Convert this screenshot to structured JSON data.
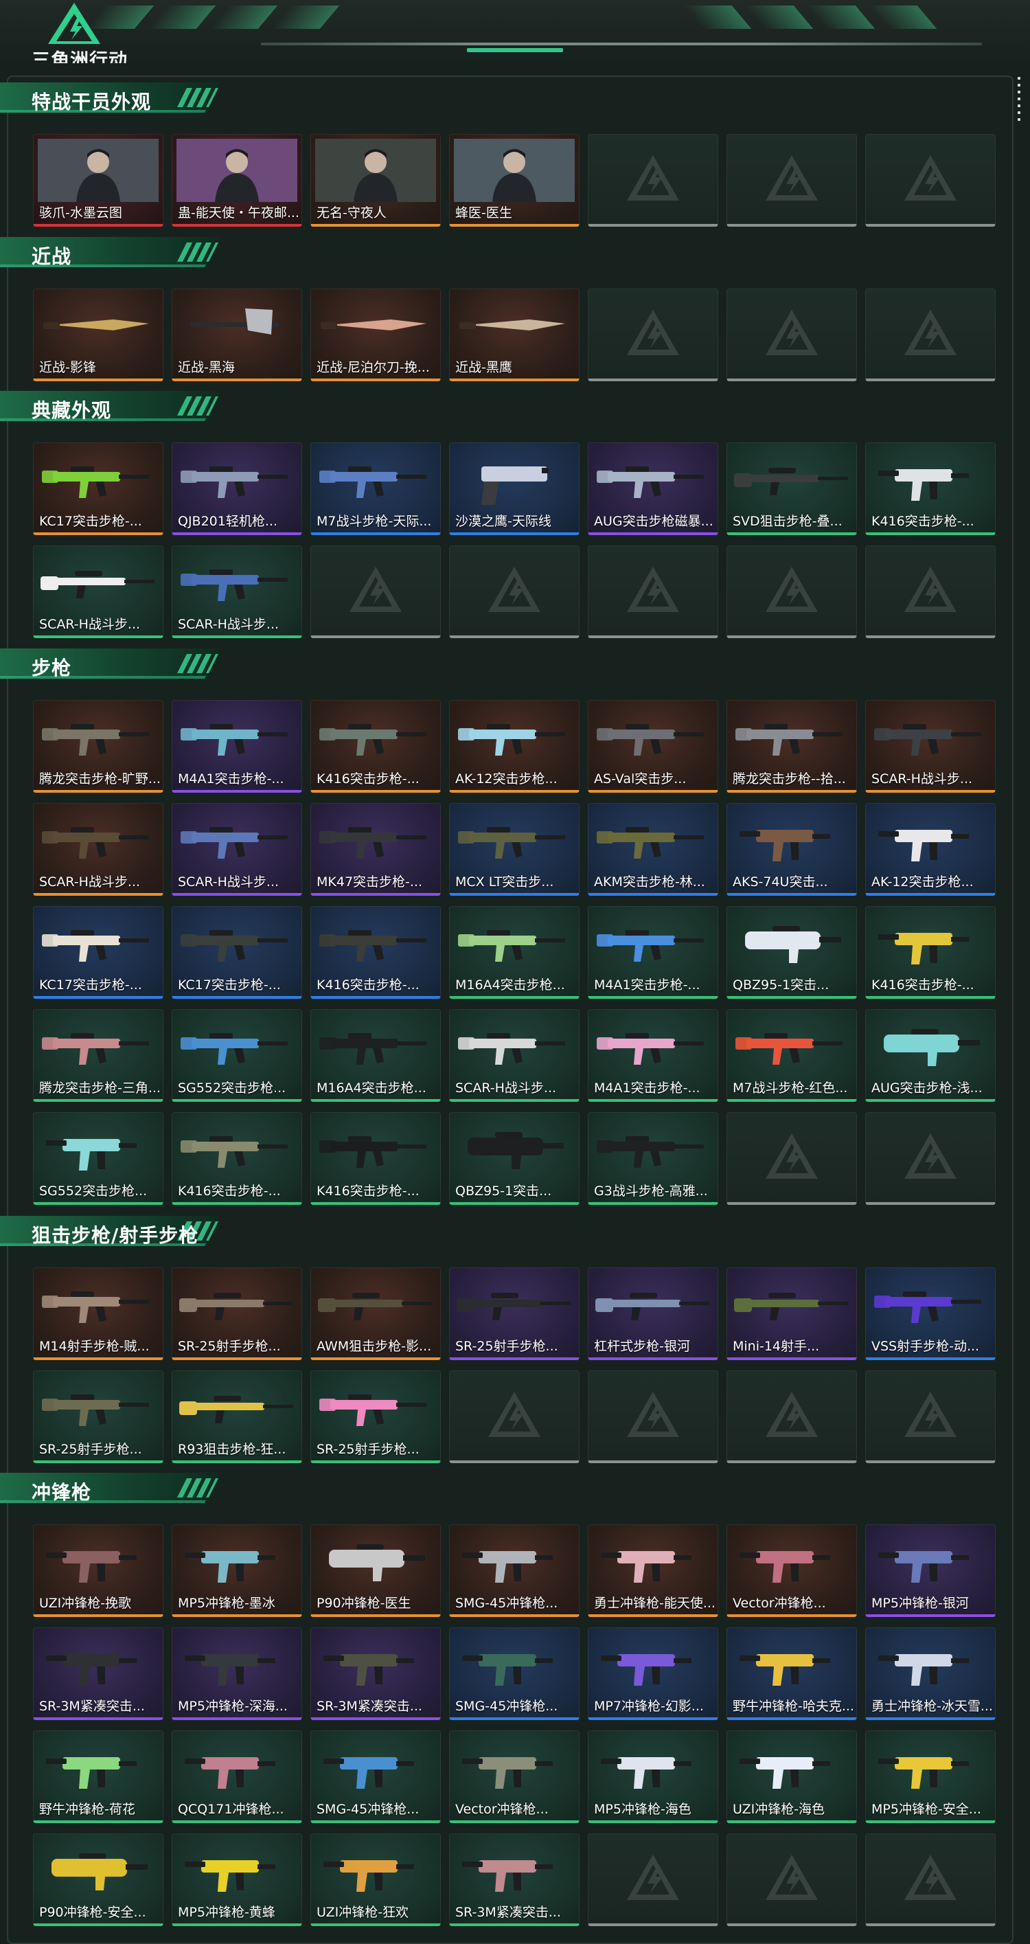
{
  "app": {
    "title": "三角洲行动"
  },
  "colors": {
    "orange": "#e8912f",
    "purple": "#8a4fe6",
    "blue": "#2e7fe8",
    "green": "#35c27a",
    "red": "#d5343a",
    "accent": "#36c58a"
  },
  "sections": [
    {
      "title": "特战干员外观",
      "rows": 1,
      "items": [
        {
          "label": "骇爪-水墨云图",
          "rarity": "red",
          "kind": "portrait",
          "tone": "#4a4f57"
        },
        {
          "label": "蛊-能天使・午夜邮...",
          "rarity": "red",
          "kind": "portrait",
          "tone": "#6c4a7a"
        },
        {
          "label": "无名-守夜人",
          "rarity": "orange",
          "kind": "portrait",
          "tone": "#3e4541"
        },
        {
          "label": "蜂医-医生",
          "rarity": "orange",
          "kind": "portrait",
          "tone": "#4d5a62"
        }
      ]
    },
    {
      "title": "近战",
      "rows": 1,
      "items": [
        {
          "label": "近战-影锋",
          "rarity": "orange",
          "kind": "knife",
          "tone": "#c9a860"
        },
        {
          "label": "近战-黑海",
          "rarity": "orange",
          "kind": "axe",
          "tone": "#b8bcc0"
        },
        {
          "label": "近战-尼泊尔刀-挽...",
          "rarity": "orange",
          "kind": "knife",
          "tone": "#d7a48e"
        },
        {
          "label": "近战-黑鹰",
          "rarity": "orange",
          "kind": "knife",
          "tone": "#c9b59a"
        }
      ]
    },
    {
      "title": "典藏外观",
      "rows": 2,
      "items": [
        {
          "label": "KC17突击步枪-...",
          "rarity": "orange",
          "kind": "rifle",
          "tone": "#7fd13a"
        },
        {
          "label": "QJB201轻机枪...",
          "rarity": "purple",
          "kind": "rifle",
          "tone": "#8e9bb6"
        },
        {
          "label": "M7战斗步枪-天际...",
          "rarity": "blue",
          "kind": "rifle",
          "tone": "#5c7fc4"
        },
        {
          "label": "沙漠之鹰-天际线",
          "rarity": "blue",
          "kind": "pistol",
          "tone": "#c8cfe0"
        },
        {
          "label": "AUG突击步枪磁暴...",
          "rarity": "purple",
          "kind": "rifle",
          "tone": "#a7b4c8"
        },
        {
          "label": "SVD狙击步枪-叠...",
          "rarity": "green",
          "kind": "sniper",
          "tone": "#3a3d3c"
        },
        {
          "label": "K416突击步枪-...",
          "rarity": "green",
          "kind": "smg",
          "tone": "#dfe3e6"
        },
        {
          "label": "SCAR-H战斗步...",
          "rarity": "green",
          "kind": "sniper",
          "tone": "#eeeeee"
        },
        {
          "label": "SCAR-H战斗步...",
          "rarity": "green",
          "kind": "rifle",
          "tone": "#4a6fb8"
        }
      ]
    },
    {
      "title": "步枪",
      "rows": 5,
      "items": [
        {
          "label": "腾龙突击步枪-旷野...",
          "rarity": "orange",
          "kind": "rifle",
          "tone": "#7a7566"
        },
        {
          "label": "M4A1突击步枪-...",
          "rarity": "purple",
          "kind": "rifle",
          "tone": "#6fb4c8"
        },
        {
          "label": "K416突击步枪-...",
          "rarity": "orange",
          "kind": "rifle",
          "tone": "#6b7a70"
        },
        {
          "label": "AK-12突击步枪...",
          "rarity": "orange",
          "kind": "rifle",
          "tone": "#9fd3e6"
        },
        {
          "label": "AS-Val突击步...",
          "rarity": "orange",
          "kind": "rifle",
          "tone": "#6d6f74"
        },
        {
          "label": "腾龙突击步枪--拾...",
          "rarity": "orange",
          "kind": "rifle",
          "tone": "#8a8c94"
        },
        {
          "label": "SCAR-H战斗步...",
          "rarity": "orange",
          "kind": "rifle",
          "tone": "#3d4045"
        },
        {
          "label": "SCAR-H战斗步...",
          "rarity": "orange",
          "kind": "rifle",
          "tone": "#5a4a36"
        },
        {
          "label": "SCAR-H战斗步...",
          "rarity": "purple",
          "kind": "rifle",
          "tone": "#5d78b8"
        },
        {
          "label": "MK47突击步枪-...",
          "rarity": "purple",
          "kind": "rifle",
          "tone": "#34363a"
        },
        {
          "label": "MCX LT突击步...",
          "rarity": "blue",
          "kind": "rifle",
          "tone": "#5e6140"
        },
        {
          "label": "AKM突击步枪-林...",
          "rarity": "blue",
          "kind": "rifle",
          "tone": "#6a6a3a"
        },
        {
          "label": "AKS-74U突击...",
          "rarity": "blue",
          "kind": "smg",
          "tone": "#7a5a44"
        },
        {
          "label": "AK-12突击步枪...",
          "rarity": "blue",
          "kind": "smg",
          "tone": "#e8e8ea"
        },
        {
          "label": "KC17突击步枪-...",
          "rarity": "blue",
          "kind": "rifle",
          "tone": "#e9e2d4"
        },
        {
          "label": "KC17突击步枪-...",
          "rarity": "blue",
          "kind": "rifle",
          "tone": "#3a3f3c"
        },
        {
          "label": "K416突击步枪-...",
          "rarity": "blue",
          "kind": "rifle",
          "tone": "#3b3d36"
        },
        {
          "label": "M16A4突击步枪...",
          "rarity": "green",
          "kind": "rifle",
          "tone": "#9dd08a"
        },
        {
          "label": "M4A1突击步枪-...",
          "rarity": "green",
          "kind": "rifle",
          "tone": "#4a8fe0"
        },
        {
          "label": "QBZ95-1突击...",
          "rarity": "green",
          "kind": "bullpup",
          "tone": "#e2e8f0"
        },
        {
          "label": "K416突击步枪-...",
          "rarity": "green",
          "kind": "smg",
          "tone": "#e3c63a"
        },
        {
          "label": "腾龙突击步枪-三角...",
          "rarity": "green",
          "kind": "rifle",
          "tone": "#c98a8e"
        },
        {
          "label": "SG552突击步枪...",
          "rarity": "green",
          "kind": "rifle",
          "tone": "#4a8fd0"
        },
        {
          "label": "M16A4突击步枪...",
          "rarity": "green",
          "kind": "rifle",
          "tone": "#1e2022"
        },
        {
          "label": "SCAR-H战斗步...",
          "rarity": "green",
          "kind": "rifle",
          "tone": "#d8d8d8"
        },
        {
          "label": "M4A1突击步枪-...",
          "rarity": "green",
          "kind": "rifle",
          "tone": "#e8a6cc"
        },
        {
          "label": "M7战斗步枪-红色...",
          "rarity": "green",
          "kind": "rifle",
          "tone": "#e8553a"
        },
        {
          "label": "AUG突击步枪-浅...",
          "rarity": "green",
          "kind": "bullpup",
          "tone": "#7fd4d4"
        },
        {
          "label": "SG552突击步枪...",
          "rarity": "green",
          "kind": "smg",
          "tone": "#8ad8d8"
        },
        {
          "label": "K416突击步枪-...",
          "rarity": "green",
          "kind": "rifle",
          "tone": "#8a8a6e"
        },
        {
          "label": "K416突击步枪-...",
          "rarity": "green",
          "kind": "rifle",
          "tone": "#1c1d1f"
        },
        {
          "label": "QBZ95-1突击...",
          "rarity": "green",
          "kind": "bullpup",
          "tone": "#1e1f21"
        },
        {
          "label": "G3战斗步枪-高雅...",
          "rarity": "green",
          "kind": "rifle",
          "tone": "#1f2022"
        }
      ]
    },
    {
      "title": "狙击步枪/射手步枪",
      "rows": 2,
      "items": [
        {
          "label": "M14射手步枪-贼...",
          "rarity": "orange",
          "kind": "rifle",
          "tone": "#a08878"
        },
        {
          "label": "SR-25射手步枪...",
          "rarity": "orange",
          "kind": "sniper",
          "tone": "#8a7a6a"
        },
        {
          "label": "AWM狙击步枪-影...",
          "rarity": "orange",
          "kind": "sniper",
          "tone": "#55503e"
        },
        {
          "label": "SR-25射手步枪...",
          "rarity": "purple",
          "kind": "sniper",
          "tone": "#2a2c30"
        },
        {
          "label": "杠杆式步枪-银河",
          "rarity": "purple",
          "kind": "sniper",
          "tone": "#8090b0"
        },
        {
          "label": "Mini-14射手...",
          "rarity": "purple",
          "kind": "sniper",
          "tone": "#5c6e3c"
        },
        {
          "label": "VSS射手步枪-动...",
          "rarity": "blue",
          "kind": "rifle",
          "tone": "#5a3ad0"
        },
        {
          "label": "SR-25射手步枪...",
          "rarity": "green",
          "kind": "rifle",
          "tone": "#6e6c50"
        },
        {
          "label": "R93狙击步枪-狂...",
          "rarity": "green",
          "kind": "sniper",
          "tone": "#e0c24a"
        },
        {
          "label": "SR-25射手步枪...",
          "rarity": "green",
          "kind": "rifle",
          "tone": "#f08ac0"
        }
      ]
    },
    {
      "title": "冲锋枪",
      "rows": 4,
      "items": [
        {
          "label": "UZI冲锋枪-挽歌",
          "rarity": "orange",
          "kind": "smg",
          "tone": "#8a6060"
        },
        {
          "label": "MP5冲锋枪-墨冰",
          "rarity": "orange",
          "kind": "smg",
          "tone": "#7ab8c8"
        },
        {
          "label": "P90冲锋枪-医生",
          "rarity": "orange",
          "kind": "bullpup",
          "tone": "#c8c8c8"
        },
        {
          "label": "SMG-45冲锋枪...",
          "rarity": "orange",
          "kind": "smg",
          "tone": "#b0b4b8"
        },
        {
          "label": "勇士冲锋枪-能天使...",
          "rarity": "orange",
          "kind": "smg",
          "tone": "#e0b0b8"
        },
        {
          "label": "Vector冲锋枪...",
          "rarity": "orange",
          "kind": "smg",
          "tone": "#c07080"
        },
        {
          "label": "MP5冲锋枪-银河",
          "rarity": "purple",
          "kind": "smg",
          "tone": "#6a7ab8"
        },
        {
          "label": "SR-3M紧凑突击...",
          "rarity": "purple",
          "kind": "smg",
          "tone": "#2e3034"
        },
        {
          "label": "MP5冲锋枪-深海...",
          "rarity": "purple",
          "kind": "smg",
          "tone": "#35383c"
        },
        {
          "label": "SR-3M紧凑突击...",
          "rarity": "purple",
          "kind": "smg",
          "tone": "#4e5042"
        },
        {
          "label": "SMG-45冲锋枪...",
          "rarity": "blue",
          "kind": "smg",
          "tone": "#3a6a5a"
        },
        {
          "label": "MP7冲锋枪-幻影...",
          "rarity": "blue",
          "kind": "smg",
          "tone": "#7a5ad8"
        },
        {
          "label": "野牛冲锋枪-哈夫克...",
          "rarity": "blue",
          "kind": "smg",
          "tone": "#e8c040"
        },
        {
          "label": "勇士冲锋枪-冰天雪...",
          "rarity": "blue",
          "kind": "smg",
          "tone": "#d0d8e8"
        },
        {
          "label": "野牛冲锋枪-荷花",
          "rarity": "green",
          "kind": "smg",
          "tone": "#8ad880"
        },
        {
          "label": "QCQ171冲锋枪...",
          "rarity": "green",
          "kind": "smg",
          "tone": "#c08090"
        },
        {
          "label": "SMG-45冲锋枪...",
          "rarity": "green",
          "kind": "smg",
          "tone": "#4a90d0"
        },
        {
          "label": "Vector冲锋枪...",
          "rarity": "green",
          "kind": "smg",
          "tone": "#8a8e7a"
        },
        {
          "label": "MP5冲锋枪-海色",
          "rarity": "green",
          "kind": "smg",
          "tone": "#e0e4ee"
        },
        {
          "label": "UZI冲锋枪-海色",
          "rarity": "green",
          "kind": "smg",
          "tone": "#e8eef8"
        },
        {
          "label": "MP5冲锋枪-安全...",
          "rarity": "green",
          "kind": "smg",
          "tone": "#e8c838"
        },
        {
          "label": "P90冲锋枪-安全...",
          "rarity": "green",
          "kind": "bullpup",
          "tone": "#e0c030"
        },
        {
          "label": "MP5冲锋枪-黄蜂",
          "rarity": "green",
          "kind": "smg",
          "tone": "#e8d028"
        },
        {
          "label": "UZI冲锋枪-狂欢",
          "rarity": "green",
          "kind": "smg",
          "tone": "#e0a040"
        },
        {
          "label": "SR-3M紧凑突击...",
          "rarity": "green",
          "kind": "smg",
          "tone": "#c08a8e"
        }
      ]
    }
  ]
}
